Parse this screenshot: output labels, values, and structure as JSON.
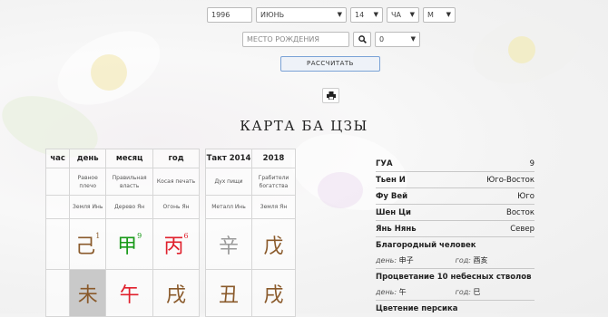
{
  "form": {
    "year": "1996",
    "month": "ИЮНЬ",
    "day": "14",
    "hour": "ЧА",
    "gender": "М",
    "birthplace_placeholder": "МЕСТО РОЖДЕНИЯ",
    "timezone": "0",
    "calc_label": "РАССЧИТАТЬ"
  },
  "title": "КАРТА БА ЦЗЫ",
  "natal": {
    "headers": [
      "час",
      "день",
      "месяц",
      "год"
    ],
    "stars": [
      "",
      "Равное плечо",
      "Правильная власть",
      "Косая печать"
    ],
    "elements": [
      "",
      "Земля Инь",
      "Дерево Ян",
      "Огонь Ян"
    ],
    "stems": [
      {
        "char": "",
        "sup": "",
        "color": "#000000"
      },
      {
        "char": "己",
        "sup": "1",
        "color": "#8a5a2b"
      },
      {
        "char": "甲",
        "sup": "9",
        "color": "#1a9a1a"
      },
      {
        "char": "丙",
        "sup": "6",
        "color": "#e0202c"
      }
    ],
    "branches": [
      {
        "char": "",
        "color": "#000000"
      },
      {
        "char": "未",
        "color": "#8a5a2b"
      },
      {
        "char": "午",
        "color": "#e0202c"
      },
      {
        "char": "戌",
        "color": "#8a5a2b"
      }
    ]
  },
  "luck": {
    "headers": [
      "Такт 2014",
      "2018"
    ],
    "stars": [
      "Дух пищи",
      "Грабители богатства"
    ],
    "elements": [
      "Металл Инь",
      "Земля Ян"
    ],
    "stems": [
      {
        "char": "辛",
        "color": "#9a9a9a"
      },
      {
        "char": "戊",
        "color": "#8a5a2b"
      }
    ],
    "branches": [
      {
        "char": "丑",
        "color": "#8a5a2b"
      },
      {
        "char": "戌",
        "color": "#8a5a2b"
      }
    ]
  },
  "info": {
    "rows": [
      {
        "label": "ГУА",
        "value": "9"
      },
      {
        "label": "Тьен И",
        "value": "Юго-Восток"
      },
      {
        "label": "Фу Вей",
        "value": "Юго"
      },
      {
        "label": "Шен Ци",
        "value": "Восток"
      },
      {
        "label": "Янь Нянь",
        "value": "Север"
      }
    ],
    "noble_title": "Благородный человек",
    "noble_day_label": "день:",
    "noble_day": "申子",
    "noble_year_label": "год:",
    "noble_year": "酉亥",
    "prosperity_title": "Процветание 10 небесных стволов",
    "prosperity_day_label": "день:",
    "prosperity_day": "午",
    "prosperity_year_label": "год:",
    "prosperity_year": "巳",
    "peach_title": "Цветение персика"
  }
}
